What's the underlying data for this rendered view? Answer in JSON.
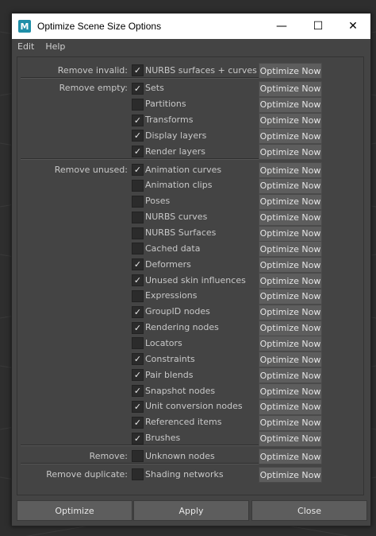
{
  "window": {
    "title": "Optimize Scene Size Options",
    "icon": "M"
  },
  "menus": [
    "Edit",
    "Help"
  ],
  "button_label": "Optimize Now",
  "rows": [
    {
      "label": "Remove invalid:",
      "item": "NURBS surfaces + curves",
      "checked": true
    },
    {
      "label": "Remove empty:",
      "item": "Sets",
      "checked": true
    },
    {
      "label": "",
      "item": "Partitions",
      "checked": false
    },
    {
      "label": "",
      "item": "Transforms",
      "checked": true
    },
    {
      "label": "",
      "item": "Display layers",
      "checked": true
    },
    {
      "label": "",
      "item": "Render layers",
      "checked": true
    },
    {
      "label": "Remove unused:",
      "item": "Animation curves",
      "checked": true
    },
    {
      "label": "",
      "item": "Animation clips",
      "checked": false
    },
    {
      "label": "",
      "item": "Poses",
      "checked": false
    },
    {
      "label": "",
      "item": "NURBS curves",
      "checked": false
    },
    {
      "label": "",
      "item": "NURBS Surfaces",
      "checked": false
    },
    {
      "label": "",
      "item": "Cached data",
      "checked": false
    },
    {
      "label": "",
      "item": "Deformers",
      "checked": true
    },
    {
      "label": "",
      "item": "Unused skin influences",
      "checked": true
    },
    {
      "label": "",
      "item": "Expressions",
      "checked": false
    },
    {
      "label": "",
      "item": "GroupID nodes",
      "checked": true
    },
    {
      "label": "",
      "item": "Rendering nodes",
      "checked": true
    },
    {
      "label": "",
      "item": "Locators",
      "checked": false
    },
    {
      "label": "",
      "item": "Constraints",
      "checked": true
    },
    {
      "label": "",
      "item": "Pair blends",
      "checked": true
    },
    {
      "label": "",
      "item": "Snapshot nodes",
      "checked": true
    },
    {
      "label": "",
      "item": "Unit conversion nodes",
      "checked": true
    },
    {
      "label": "",
      "item": "Referenced items",
      "checked": true
    },
    {
      "label": "",
      "item": "Brushes",
      "checked": true
    },
    {
      "label": "Remove:",
      "item": "Unknown nodes",
      "checked": false
    },
    {
      "label": "Remove duplicate:",
      "item": "Shading networks",
      "checked": false
    }
  ],
  "bottom_buttons": {
    "optimize": "Optimize",
    "apply": "Apply",
    "close": "Close"
  }
}
